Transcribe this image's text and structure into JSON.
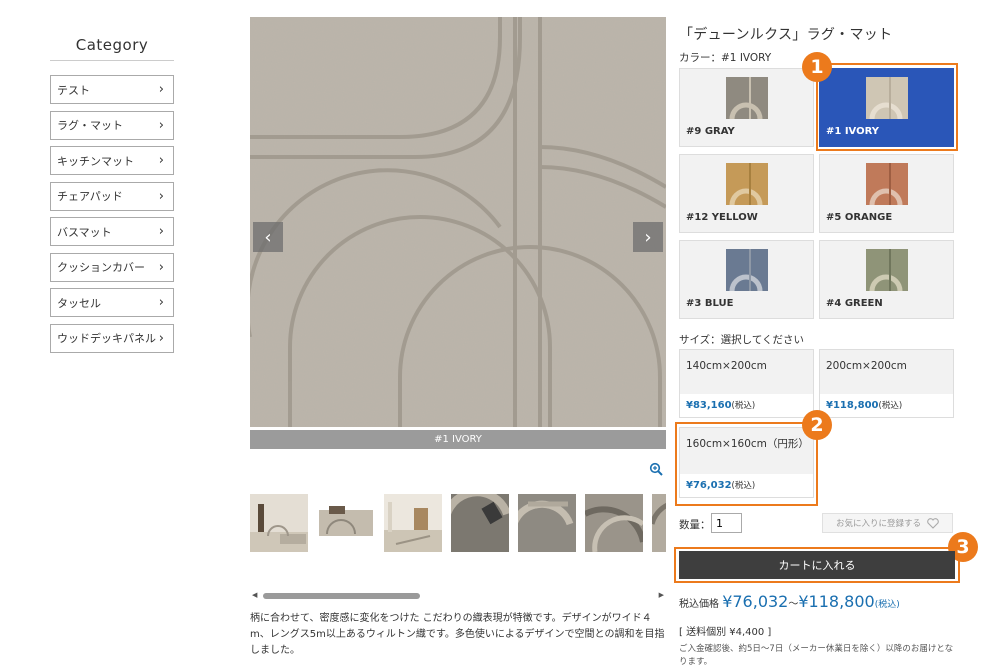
{
  "sidebar": {
    "title": "Category",
    "items": [
      {
        "label": "テスト"
      },
      {
        "label": "ラグ・マット"
      },
      {
        "label": "キッチンマット"
      },
      {
        "label": "チェアパッド"
      },
      {
        "label": "バスマット"
      },
      {
        "label": "クッションカバー"
      },
      {
        "label": "タッセル"
      },
      {
        "label": "ウッドデッキパネル"
      }
    ],
    "chevron": "›"
  },
  "gallery": {
    "caption": "#1 IVORY",
    "prev_icon": "chevron-left-icon",
    "next_icon": "chevron-right-icon",
    "zoom_icon": "zoom-in-icon",
    "thumbnail_count": 7
  },
  "description": "柄に合わせて、密度感に変化をつけた こだわりの織表現が特徴です。デザインがワイド４m、レングス5m以上あるウィルトン織です。多色使いによるデザインで空間との調和を目指しました。",
  "product": {
    "title": "「デューンルクス」ラグ・マット",
    "color_label": "カラー：#1 IVORY",
    "colors": [
      {
        "label": "#9 GRAY",
        "selected": false,
        "tile": "#8f8a80",
        "accent": "#c8c0b0"
      },
      {
        "label": "#1 IVORY",
        "selected": true,
        "tile": "#cfc6b4",
        "accent": "#e6ded0"
      },
      {
        "label": "#12 YELLOW",
        "selected": false,
        "tile": "#c59a58",
        "accent": "#d9b98b"
      },
      {
        "label": "#5 ORANGE",
        "selected": false,
        "tile": "#c07a5a",
        "accent": "#d9b4a0"
      },
      {
        "label": "#3 BLUE",
        "selected": false,
        "tile": "#6a7a92",
        "accent": "#b0b8c4"
      },
      {
        "label": "#4 GREEN",
        "selected": false,
        "tile": "#8f9478",
        "accent": "#c4c2a8"
      }
    ],
    "size_label": "サイズ：選択してください",
    "sizes": [
      {
        "name": "140cm×200cm",
        "price": "¥83,160",
        "tax": "(税込)"
      },
      {
        "name": "200cm×200cm",
        "price": "¥118,800",
        "tax": "(税込)"
      },
      {
        "name": "160cm×160cm（円形）",
        "price": "¥76,032",
        "tax": "(税込)"
      }
    ],
    "qty_label": "数量：",
    "qty_value": "1",
    "favorite_label": "お気に入りに登録する",
    "cart_label": "カートに入れる",
    "price_prefix": "税込価格",
    "price_min": "¥76,032",
    "price_sep": "～",
    "price_max": "¥118,800",
    "price_tax": "(税込)",
    "shipping": "[ 送料個別 ¥4,400 ]",
    "delivery": "ご入金確認後、約5日～7日（メーカー休業日を除く）以降のお届けとなります。"
  },
  "annotations": {
    "badges": [
      "1",
      "2",
      "3"
    ],
    "color": "#ec7a1c"
  },
  "colors": {
    "selected_swatch": "#2a56b8",
    "price_blue": "#1a6fb0",
    "cart_button": "#3e3e3e"
  }
}
